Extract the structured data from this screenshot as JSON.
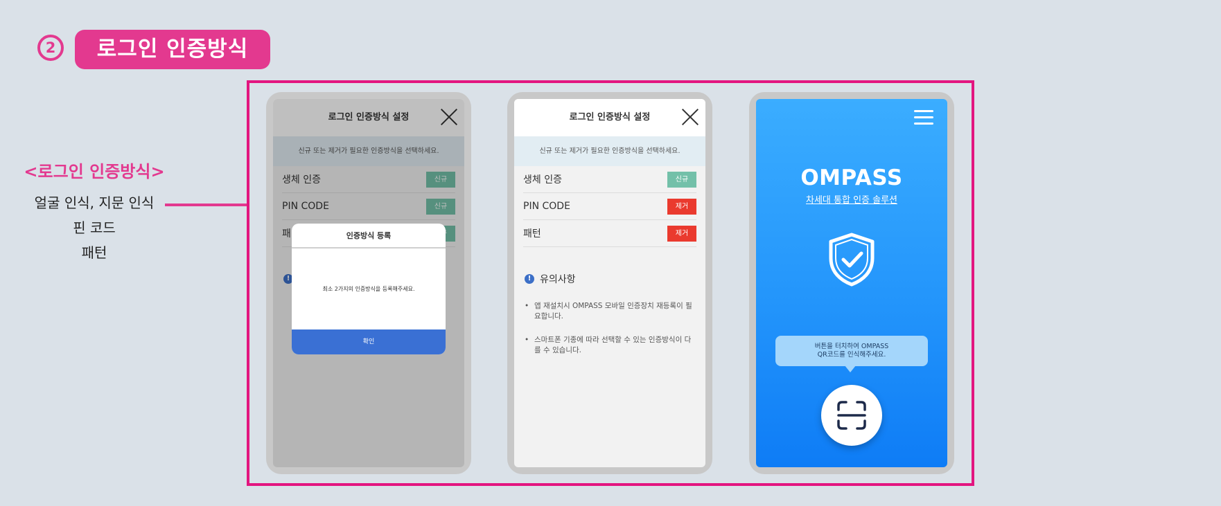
{
  "heading": {
    "step_number": "2",
    "title": "로그인 인증방식"
  },
  "legend": {
    "title": "<로그인 인증방식>",
    "lines": [
      "얼굴 인식, 지문 인식",
      "핀 코드",
      "패턴"
    ]
  },
  "settings": {
    "title": "로그인 인증방식 설정",
    "info": "신규 또는 제거가 필요한 인증방식을 선택하세요.",
    "methods": [
      {
        "label": "생체 인증",
        "action": "신규",
        "action_color": "#73c0a9"
      },
      {
        "label": "PIN CODE",
        "action": "제거",
        "action_color": "#ea3a2e"
      },
      {
        "label": "패턴",
        "action": "제거",
        "action_color": "#ea3a2e"
      }
    ],
    "notes_title": "유의사항",
    "notes": [
      "앱 재설치시 OMPASS 모바일 인증장치 재등록이 필요합니다.",
      "스마트폰 기종에 따라 선택할 수 있는 인증방식이 다를 수 있습니다."
    ]
  },
  "screen1": {
    "methods": [
      {
        "label": "생체 인증",
        "action": "신규"
      },
      {
        "label": "PIN CODE",
        "action": "신규"
      },
      {
        "label": "패턴",
        "action": "신규"
      }
    ],
    "dialog": {
      "title": "인증방식 등록",
      "message": "최소 2가지의 인증방식을 등록해주세요.",
      "confirm": "확인"
    }
  },
  "main_screen": {
    "brand": "OMPASS",
    "tagline": "차세대 통합 인증 솔루션",
    "bubble_line1": "버튼을 터치하여 OMPASS",
    "bubble_line2": "QR코드를 인식해주세요."
  },
  "icons": {
    "close": "close-icon",
    "menu": "hamburger-menu-icon",
    "shield": "shield-check-icon",
    "scan": "qr-scan-icon",
    "notice": "exclamation-icon"
  },
  "colors": {
    "accent": "#e3398f",
    "frame": "#e3157f",
    "new_tag": "#73c0a9",
    "remove_tag": "#ea3a2e",
    "confirm_button": "#3a70d4",
    "brand_blue": "#2395fb"
  }
}
